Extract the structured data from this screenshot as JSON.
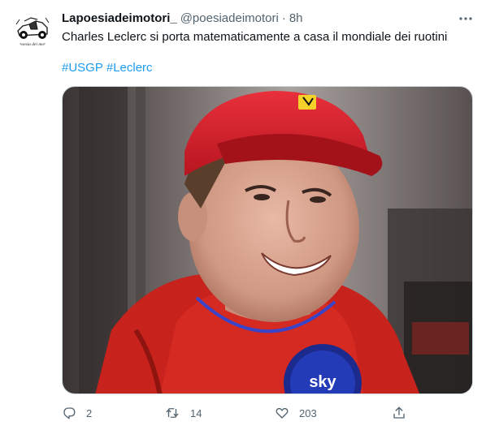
{
  "tweet": {
    "author": {
      "display_name": "Lapoesiadeimotori_",
      "handle": "@poesiadeimotori",
      "avatar_icon": "race-car-drawing-icon",
      "avatar_caption": "la poesia dei motori"
    },
    "separator": "·",
    "time": "8h",
    "text": "Charles Leclerc si porta matematicamente a casa il mondiale dei ruotini",
    "hashtags": [
      "#USGP",
      "#Leclerc"
    ],
    "media": {
      "watermark": "sky"
    },
    "actions": {
      "reply": {
        "icon": "reply-icon",
        "count": "2"
      },
      "retweet": {
        "icon": "retweet-icon",
        "count": "14"
      },
      "like": {
        "icon": "heart-icon",
        "count": "203"
      },
      "share": {
        "icon": "share-icon"
      }
    },
    "more_icon": "more-options-icon"
  },
  "colors": {
    "link": "#1d9bf0",
    "secondary_text": "#536471",
    "primary_text": "#0f1419"
  }
}
